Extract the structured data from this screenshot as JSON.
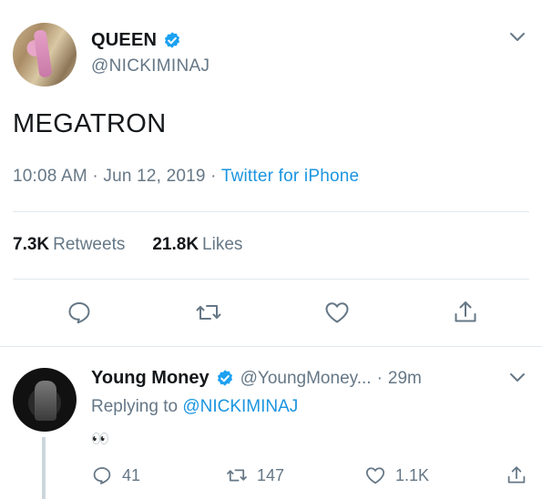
{
  "main_tweet": {
    "display_name": "QUEEN",
    "handle": "@NICKIMINAJ",
    "text": "MEGATRON",
    "time": "10:08 AM",
    "date": "Jun 12, 2019",
    "separator": "·",
    "source": "Twitter for iPhone",
    "retweets_count": "7.3K",
    "retweets_label": "Retweets",
    "likes_count": "21.8K",
    "likes_label": "Likes"
  },
  "reply": {
    "display_name": "Young Money",
    "handle": "@YoungMoney...",
    "separator": "·",
    "time": "29m",
    "replying_to_label": "Replying to",
    "replying_to_mention": "@NICKIMINAJ",
    "text": "👀",
    "reply_count": "41",
    "retweet_count": "147",
    "like_count": "1.1K"
  },
  "colors": {
    "text": "#14171a",
    "secondary": "#657786",
    "accent": "#1b95e0",
    "verified": "#1da1f2",
    "divider": "#e1e8ed"
  },
  "icons": {
    "verified": "verified-badge-icon",
    "chevron": "chevron-down-icon",
    "reply": "reply-bubble-icon",
    "retweet": "retweet-icon",
    "like": "heart-icon",
    "share": "share-icon"
  }
}
